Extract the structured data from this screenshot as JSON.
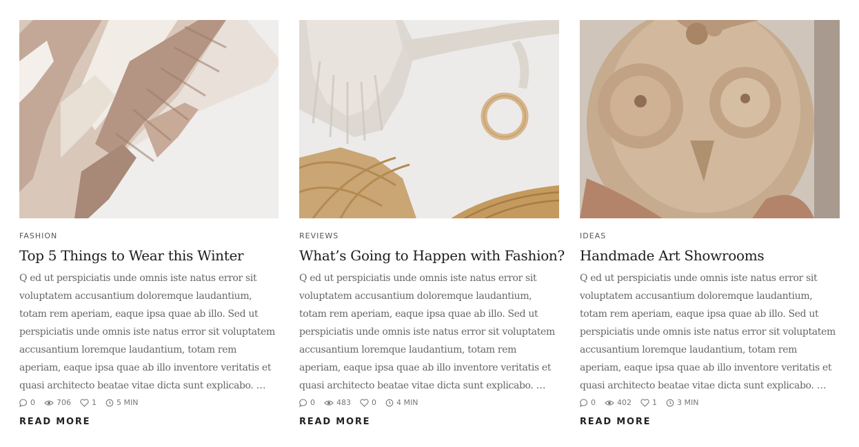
{
  "posts": [
    {
      "image_alt": "knitted tassel blanket",
      "category": "FASHION",
      "title": "Top 5 Things to Wear this Winter",
      "excerpt": "Q ed ut perspiciatis unde omnis iste natus error sit voluptatem accusantium doloremque laudantium, totam rem aperiam, eaque ipsa quae ab illo. Sed ut perspiciatis unde omnis iste natus error sit voluptatem accusantium loremque laudantium, totam rem aperiam, eaque ipsa quae ab illo inventore veritatis et quasi architecto beatae vitae dicta sunt explicabo. …",
      "comments": "0",
      "views": "706",
      "likes": "1",
      "read_time": "5 MIN",
      "read_more": "READ MORE"
    },
    {
      "image_alt": "macrame with wooden ring and palm leaves",
      "category": "REVIEWS",
      "title": "What’s Going to Happen with Fashion?",
      "excerpt": "Q ed ut perspiciatis unde omnis iste natus error sit voluptatem accusantium doloremque laudantium, totam rem aperiam, eaque ipsa quae ab illo. Sed ut perspiciatis unde omnis iste natus error sit voluptatem accusantium loremque laudantium, totam rem aperiam, eaque ipsa quae ab illo inventore veritatis et quasi architecto beatae vitae dicta sunt explicabo. …",
      "comments": "0",
      "views": "483",
      "likes": "0",
      "read_time": "4 MIN",
      "read_more": "READ MORE"
    },
    {
      "image_alt": "handmade ceramic owl",
      "category": "IDEAS",
      "title": "Handmade Art Showrooms",
      "excerpt": "Q ed ut perspiciatis unde omnis iste natus error sit voluptatem accusantium doloremque laudantium, totam rem aperiam, eaque ipsa quae ab illo. Sed ut perspiciatis unde omnis iste natus error sit voluptatem accusantium loremque laudantium, totam rem aperiam, eaque ipsa quae ab illo inventore veritatis et quasi architecto beatae vitae dicta sunt explicabo. …",
      "comments": "0",
      "views": "402",
      "likes": "1",
      "read_time": "3 MIN",
      "read_more": "READ MORE"
    }
  ],
  "icons": {
    "comments": "comment-bubble-icon",
    "views": "eye-icon",
    "likes": "heart-icon",
    "read_time": "clock-icon"
  },
  "colors": {
    "text": "#1c1c1c",
    "muted": "#666666",
    "meta": "#777777"
  }
}
